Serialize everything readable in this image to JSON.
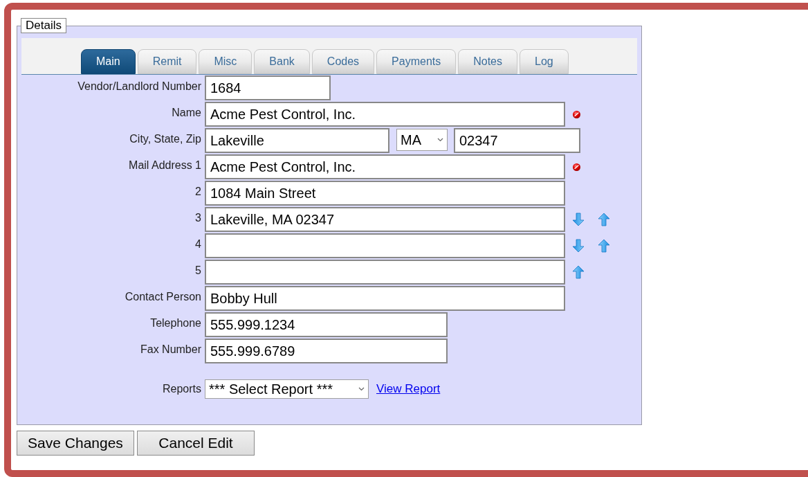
{
  "panel": {
    "legend": "Details"
  },
  "tabs": [
    {
      "label": "Main",
      "selected": true
    },
    {
      "label": "Remit",
      "selected": false
    },
    {
      "label": "Misc",
      "selected": false
    },
    {
      "label": "Bank",
      "selected": false
    },
    {
      "label": "Codes",
      "selected": false
    },
    {
      "label": "Payments",
      "selected": false
    },
    {
      "label": "Notes",
      "selected": false
    },
    {
      "label": "Log",
      "selected": false
    }
  ],
  "fields": [
    {
      "label": "Vendor/Landlord Number",
      "inputs": [
        {
          "kind": "number",
          "value": "1684"
        }
      ],
      "required": false,
      "move_down": false,
      "move_up": false
    },
    {
      "label": "Name",
      "inputs": [
        {
          "kind": "line",
          "value": "Acme Pest Control, Inc."
        }
      ],
      "required": true,
      "move_down": false,
      "move_up": false
    },
    {
      "label": "City, State, Zip",
      "inputs": [
        {
          "kind": "city",
          "value": "Lakeville"
        },
        {
          "kind": "state",
          "value": "MA"
        },
        {
          "kind": "zip",
          "value": "02347"
        }
      ],
      "required": false,
      "move_down": false,
      "move_up": false
    },
    {
      "label": "Mail Address 1",
      "inputs": [
        {
          "kind": "line",
          "value": "Acme Pest Control, Inc."
        }
      ],
      "required": true,
      "move_down": false,
      "move_up": false
    },
    {
      "label": "2",
      "inputs": [
        {
          "kind": "line",
          "value": "1084 Main Street"
        }
      ],
      "required": false,
      "move_down": false,
      "move_up": false
    },
    {
      "label": "3",
      "inputs": [
        {
          "kind": "line",
          "value": "Lakeville, MA 02347"
        }
      ],
      "required": false,
      "move_down": true,
      "move_up": true
    },
    {
      "label": "4",
      "inputs": [
        {
          "kind": "line"
        }
      ],
      "required": false,
      "move_down": true,
      "move_up": true
    },
    {
      "label": "5",
      "inputs": [
        {
          "kind": "line"
        }
      ],
      "required": false,
      "move_down": false,
      "move_up": true
    },
    {
      "label": "Contact Person",
      "inputs": [
        {
          "kind": "line",
          "value": "Bobby Hull"
        }
      ],
      "required": false,
      "move_down": false,
      "move_up": false
    },
    {
      "label": "Telephone",
      "inputs": [
        {
          "kind": "phone",
          "value": "555.999.1234"
        }
      ],
      "required": false,
      "move_down": false,
      "move_up": false
    },
    {
      "label": "Fax Number",
      "inputs": [
        {
          "kind": "phone",
          "value": "555.999.6789"
        }
      ],
      "required": false,
      "move_down": false,
      "move_up": false
    }
  ],
  "reports": {
    "label": "Reports",
    "select": "*** Select Report ***",
    "link": "View Report"
  },
  "buttons": [
    "Save Changes",
    "Cancel Edit"
  ]
}
